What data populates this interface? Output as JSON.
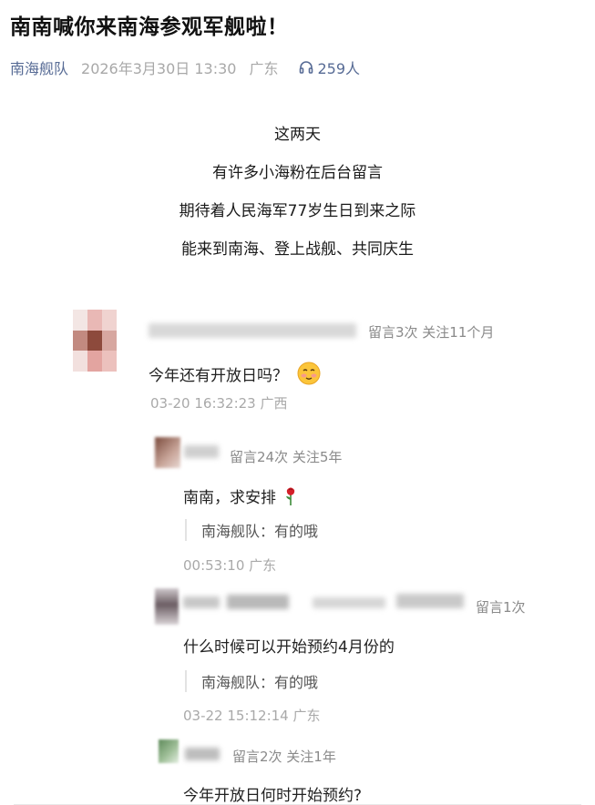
{
  "article": {
    "title": "南南喊你来南海参观军舰啦！",
    "account": "南海舰队",
    "date": "2026年3月30日 13:30",
    "location": "广东",
    "listen_count": "259人",
    "body_lines": [
      "这两天",
      "有许多小海粉在后台留言",
      "期待着人民海军77岁生日到来之际",
      "能来到南海、登上战舰、共同庆生"
    ]
  },
  "comments": [
    {
      "stats": "留言3次 关注11个月",
      "text": "今年还有开放日吗？",
      "emoji": "blush-face-icon",
      "time": "03-20 16:32:23 广西",
      "replies": [
        {
          "stats": "留言24次 关注5年",
          "text": "南南，求安排",
          "emoji": "rose-icon",
          "official_reply": "南海舰队：有的哦",
          "time": "00:53:10 广东"
        },
        {
          "stats": "留言1次",
          "text": "什么时候可以开始预约4月份的",
          "official_reply": "南海舰队：有的哦",
          "time": "03-22 15:12:14 广东"
        },
        {
          "stats": "留言2次 关注1年",
          "text": "今年开放日何时开始预约?"
        }
      ]
    }
  ],
  "colors": {
    "link": "#576b95",
    "meta": "#a8a8a8",
    "text": "#1f1f1f"
  }
}
